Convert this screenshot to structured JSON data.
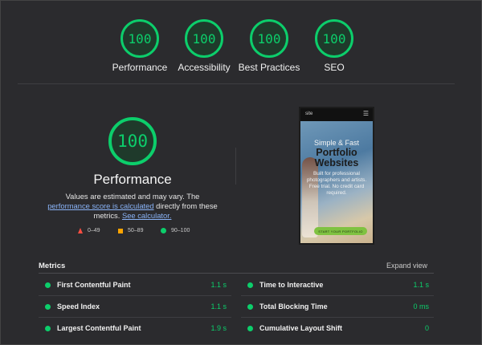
{
  "categories": [
    {
      "score": "100",
      "label": "Performance"
    },
    {
      "score": "100",
      "label": "Accessibility"
    },
    {
      "score": "100",
      "label": "Best Practices"
    },
    {
      "score": "100",
      "label": "SEO"
    }
  ],
  "main": {
    "score": "100",
    "title": "Performance",
    "desc_pre": "Values are estimated and may vary. The ",
    "desc_link1": "performance score is calculated",
    "desc_mid": " directly from these metrics. ",
    "desc_link2": "See calculator.",
    "legend": [
      {
        "range": "0–49",
        "color": "#ff4e42"
      },
      {
        "range": "50–89",
        "color": "#ffa400"
      },
      {
        "range": "90–100",
        "color": "#0cce6b"
      }
    ]
  },
  "screenshot": {
    "logo": "site",
    "menu": "☰",
    "line1": "Simple & Fast",
    "line2": "Portfolio Websites",
    "line3": "Built for professional photographers and artists. Free trial. No credit card required.",
    "button": "START YOUR PORTFOLIO"
  },
  "metrics": {
    "title": "Metrics",
    "expand": "Expand view",
    "left": [
      {
        "label": "First Contentful Paint",
        "value": "1.1 s"
      },
      {
        "label": "Speed Index",
        "value": "1.1 s"
      },
      {
        "label": "Largest Contentful Paint",
        "value": "1.9 s"
      }
    ],
    "right": [
      {
        "label": "Time to Interactive",
        "value": "1.1 s"
      },
      {
        "label": "Total Blocking Time",
        "value": "0 ms"
      },
      {
        "label": "Cumulative Layout Shift",
        "value": "0"
      }
    ]
  },
  "colors": {
    "pass": "#0cce6b",
    "average": "#ffa400",
    "fail": "#ff4e42",
    "background": "#2b2b2e"
  }
}
